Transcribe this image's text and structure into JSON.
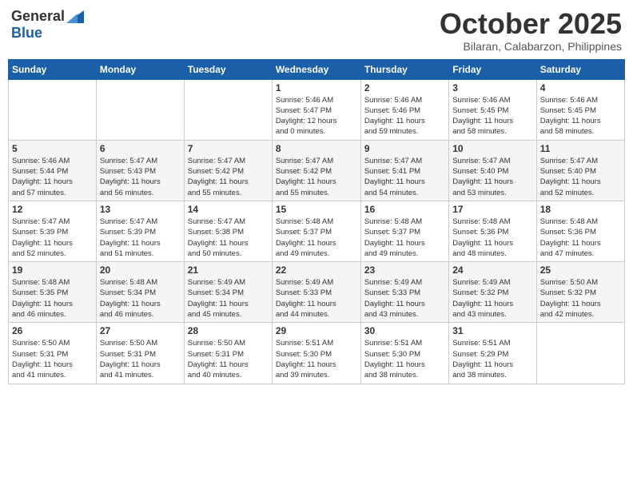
{
  "header": {
    "logo_general": "General",
    "logo_blue": "Blue",
    "month_title": "October 2025",
    "location": "Bilaran, Calabarzon, Philippines"
  },
  "weekdays": [
    "Sunday",
    "Monday",
    "Tuesday",
    "Wednesday",
    "Thursday",
    "Friday",
    "Saturday"
  ],
  "weeks": [
    [
      {
        "day": "",
        "info": ""
      },
      {
        "day": "",
        "info": ""
      },
      {
        "day": "",
        "info": ""
      },
      {
        "day": "1",
        "info": "Sunrise: 5:46 AM\nSunset: 5:47 PM\nDaylight: 12 hours\nand 0 minutes."
      },
      {
        "day": "2",
        "info": "Sunrise: 5:46 AM\nSunset: 5:46 PM\nDaylight: 11 hours\nand 59 minutes."
      },
      {
        "day": "3",
        "info": "Sunrise: 5:46 AM\nSunset: 5:45 PM\nDaylight: 11 hours\nand 58 minutes."
      },
      {
        "day": "4",
        "info": "Sunrise: 5:46 AM\nSunset: 5:45 PM\nDaylight: 11 hours\nand 58 minutes."
      }
    ],
    [
      {
        "day": "5",
        "info": "Sunrise: 5:46 AM\nSunset: 5:44 PM\nDaylight: 11 hours\nand 57 minutes."
      },
      {
        "day": "6",
        "info": "Sunrise: 5:47 AM\nSunset: 5:43 PM\nDaylight: 11 hours\nand 56 minutes."
      },
      {
        "day": "7",
        "info": "Sunrise: 5:47 AM\nSunset: 5:42 PM\nDaylight: 11 hours\nand 55 minutes."
      },
      {
        "day": "8",
        "info": "Sunrise: 5:47 AM\nSunset: 5:42 PM\nDaylight: 11 hours\nand 55 minutes."
      },
      {
        "day": "9",
        "info": "Sunrise: 5:47 AM\nSunset: 5:41 PM\nDaylight: 11 hours\nand 54 minutes."
      },
      {
        "day": "10",
        "info": "Sunrise: 5:47 AM\nSunset: 5:40 PM\nDaylight: 11 hours\nand 53 minutes."
      },
      {
        "day": "11",
        "info": "Sunrise: 5:47 AM\nSunset: 5:40 PM\nDaylight: 11 hours\nand 52 minutes."
      }
    ],
    [
      {
        "day": "12",
        "info": "Sunrise: 5:47 AM\nSunset: 5:39 PM\nDaylight: 11 hours\nand 52 minutes."
      },
      {
        "day": "13",
        "info": "Sunrise: 5:47 AM\nSunset: 5:39 PM\nDaylight: 11 hours\nand 51 minutes."
      },
      {
        "day": "14",
        "info": "Sunrise: 5:47 AM\nSunset: 5:38 PM\nDaylight: 11 hours\nand 50 minutes."
      },
      {
        "day": "15",
        "info": "Sunrise: 5:48 AM\nSunset: 5:37 PM\nDaylight: 11 hours\nand 49 minutes."
      },
      {
        "day": "16",
        "info": "Sunrise: 5:48 AM\nSunset: 5:37 PM\nDaylight: 11 hours\nand 49 minutes."
      },
      {
        "day": "17",
        "info": "Sunrise: 5:48 AM\nSunset: 5:36 PM\nDaylight: 11 hours\nand 48 minutes."
      },
      {
        "day": "18",
        "info": "Sunrise: 5:48 AM\nSunset: 5:36 PM\nDaylight: 11 hours\nand 47 minutes."
      }
    ],
    [
      {
        "day": "19",
        "info": "Sunrise: 5:48 AM\nSunset: 5:35 PM\nDaylight: 11 hours\nand 46 minutes."
      },
      {
        "day": "20",
        "info": "Sunrise: 5:48 AM\nSunset: 5:34 PM\nDaylight: 11 hours\nand 46 minutes."
      },
      {
        "day": "21",
        "info": "Sunrise: 5:49 AM\nSunset: 5:34 PM\nDaylight: 11 hours\nand 45 minutes."
      },
      {
        "day": "22",
        "info": "Sunrise: 5:49 AM\nSunset: 5:33 PM\nDaylight: 11 hours\nand 44 minutes."
      },
      {
        "day": "23",
        "info": "Sunrise: 5:49 AM\nSunset: 5:33 PM\nDaylight: 11 hours\nand 43 minutes."
      },
      {
        "day": "24",
        "info": "Sunrise: 5:49 AM\nSunset: 5:32 PM\nDaylight: 11 hours\nand 43 minutes."
      },
      {
        "day": "25",
        "info": "Sunrise: 5:50 AM\nSunset: 5:32 PM\nDaylight: 11 hours\nand 42 minutes."
      }
    ],
    [
      {
        "day": "26",
        "info": "Sunrise: 5:50 AM\nSunset: 5:31 PM\nDaylight: 11 hours\nand 41 minutes."
      },
      {
        "day": "27",
        "info": "Sunrise: 5:50 AM\nSunset: 5:31 PM\nDaylight: 11 hours\nand 41 minutes."
      },
      {
        "day": "28",
        "info": "Sunrise: 5:50 AM\nSunset: 5:31 PM\nDaylight: 11 hours\nand 40 minutes."
      },
      {
        "day": "29",
        "info": "Sunrise: 5:51 AM\nSunset: 5:30 PM\nDaylight: 11 hours\nand 39 minutes."
      },
      {
        "day": "30",
        "info": "Sunrise: 5:51 AM\nSunset: 5:30 PM\nDaylight: 11 hours\nand 38 minutes."
      },
      {
        "day": "31",
        "info": "Sunrise: 5:51 AM\nSunset: 5:29 PM\nDaylight: 11 hours\nand 38 minutes."
      },
      {
        "day": "",
        "info": ""
      }
    ]
  ]
}
